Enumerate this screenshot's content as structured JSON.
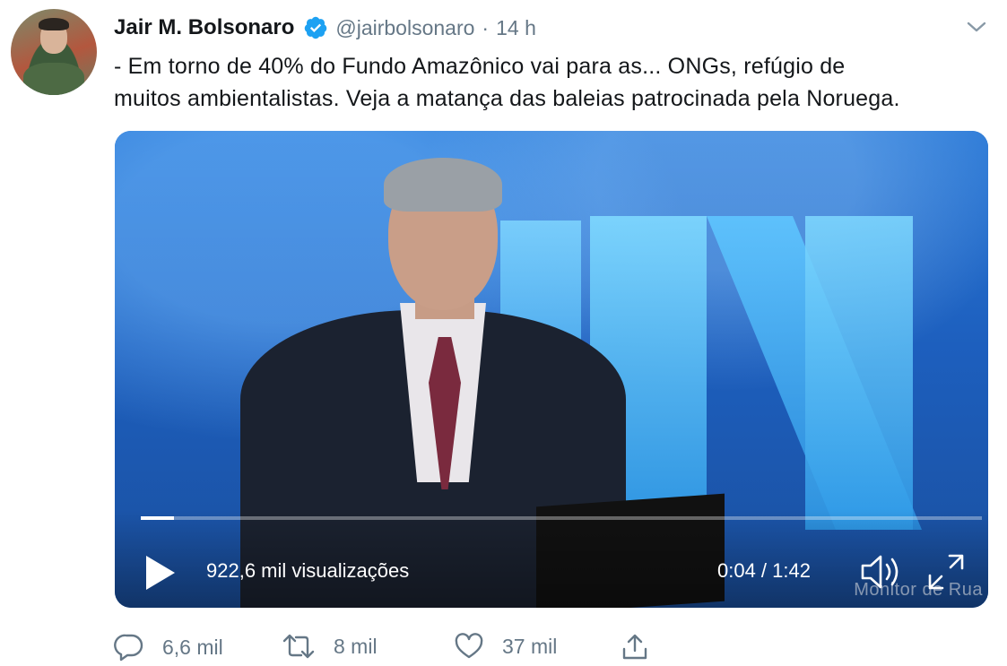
{
  "author": {
    "display_name": "Jair M. Bolsonaro",
    "handle": "@jairbolsonaro",
    "separator": "·",
    "time": "14 h",
    "verified": true
  },
  "tweet": {
    "text_lines": [
      "- Em torno de 40% do Fundo Amazônico vai para as... ONGs, refúgio de",
      "muitos ambientalistas. Veja a matança das baleias patrocinada pela Noruega."
    ]
  },
  "video": {
    "views": "922,6 mil visualizações",
    "time_display": "0:04 / 1:42",
    "progress_fraction": 0.0392,
    "watermark": "Monitor de Rua"
  },
  "actions": {
    "reply_count": "6,6 mil",
    "retweet_count": "8 mil",
    "like_count": "37 mil"
  },
  "colors": {
    "accent": "#1da1f2",
    "muted": "#657786",
    "text": "#14171a"
  }
}
